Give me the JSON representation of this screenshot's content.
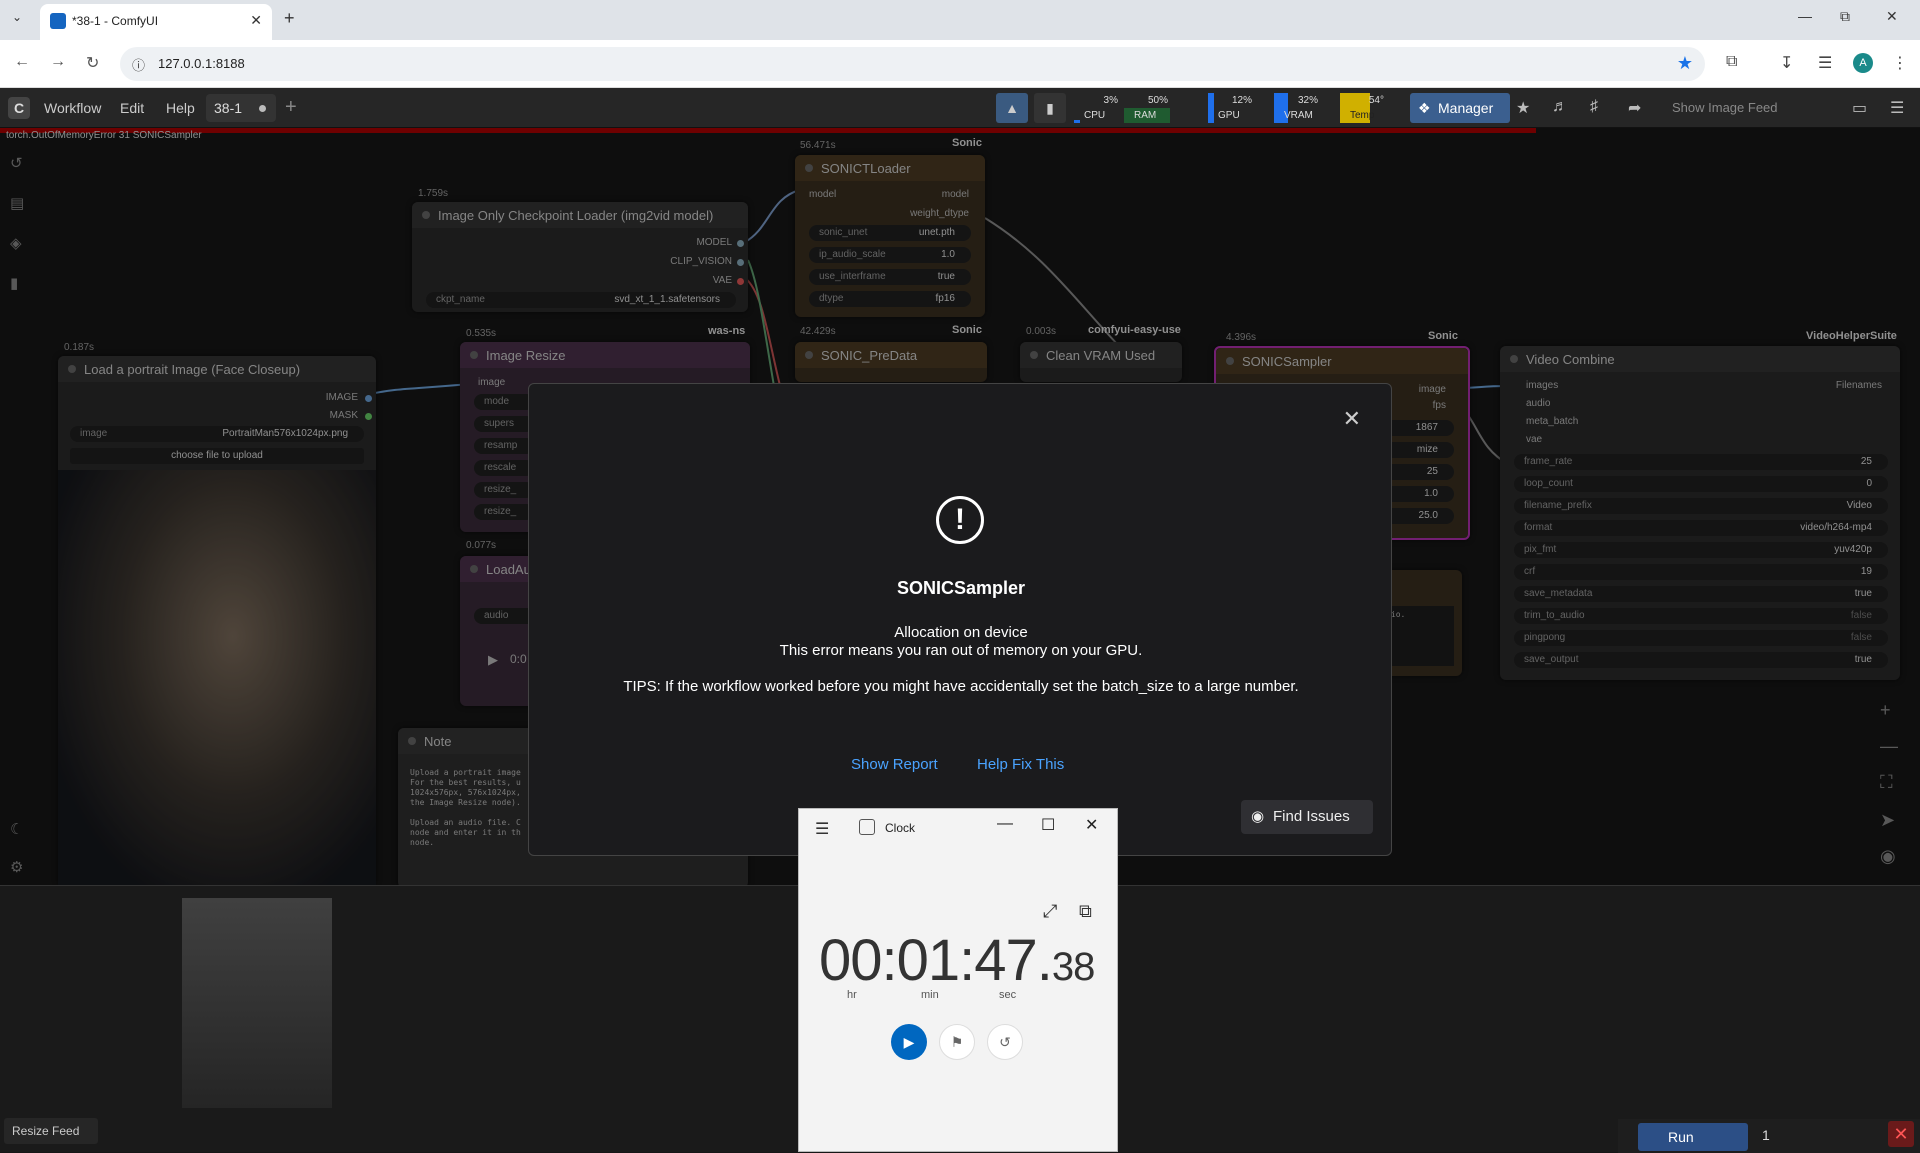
{
  "browser": {
    "tab_title": "*38-1 - ComfyUI",
    "url": "127.0.0.1:8188",
    "avatar_letter": "A"
  },
  "comfy": {
    "menu": [
      "Workflow",
      "Edit",
      "Help"
    ],
    "workflow_tab": "38-1",
    "monitors": [
      {
        "label": "CPU",
        "pct": "3%",
        "color": "#1f6feb"
      },
      {
        "label": "RAM",
        "pct": "50%",
        "color": "#1a7f37"
      },
      {
        "label": "GPU",
        "pct": "12%",
        "color": "#1f6feb"
      },
      {
        "label": "VRAM",
        "pct": "32%",
        "color": "#1f6feb"
      },
      {
        "label": "Temp",
        "pct": "54°",
        "color": "#d0b000"
      }
    ],
    "manager_label": "Manager",
    "show_feed_label": "Show Image Feed",
    "error_strip": "torch.OutOfMemoryError 31 SONICSampler"
  },
  "nodes": {
    "checkpoint": {
      "time": "1.759s",
      "title": "Image Only Checkpoint Loader (img2vid model)",
      "outputs": [
        "MODEL",
        "CLIP_VISION",
        "VAE"
      ],
      "ckpt_label": "ckpt_name",
      "ckpt_value": "svd_xt_1_1.safetensors"
    },
    "loader": {
      "time": "56.471s",
      "group": "Sonic",
      "title": "SONICTLoader",
      "in_model": "model",
      "out_model": "model",
      "out_dtype": "weight_dtype",
      "widgets": [
        {
          "l": "sonic_unet",
          "v": "unet.pth"
        },
        {
          "l": "ip_audio_scale",
          "v": "1.0"
        },
        {
          "l": "use_interframe",
          "v": "true"
        },
        {
          "l": "dtype",
          "v": "fp16"
        }
      ]
    },
    "portrait": {
      "time": "0.187s",
      "title": "Load a portrait Image (Face Closeup)",
      "outputs": [
        "IMAGE",
        "MASK"
      ],
      "image_label": "image",
      "image_value": "PortraitMan576x1024px.png",
      "upload_label": "choose file to upload"
    },
    "resize": {
      "time": "0.535s",
      "group": "was-ns",
      "title": "Image Resize",
      "input": "image",
      "widgets": [
        "mode",
        "supers",
        "resamp",
        "rescale",
        "resize_",
        "resize_"
      ]
    },
    "predata": {
      "time": "42.429s",
      "group": "Sonic",
      "title": "SONIC_PreData"
    },
    "cleanvram": {
      "time": "0.003s",
      "group": "comfyui-easy-use",
      "title": "Clean VRAM Used"
    },
    "sampler": {
      "time": "4.396s",
      "group": "Sonic",
      "title": "SONICSampler",
      "out_image": "image",
      "out_fps": "fps",
      "values": [
        "1867",
        "mize",
        "25",
        "1.0",
        "25.0"
      ]
    },
    "loadaudio": {
      "time": "0.077s",
      "title": "LoadAu",
      "widget": "audio",
      "play_time": "0:0"
    },
    "note": {
      "title": "Note",
      "text": "Upload a portrait image\nFor the best results, u\n1024x576px, 576x1024px,\nthe Image Resize node).\n\nUpload an audio file. C\nnode and enter it in th\nnode."
    },
    "previewtext": "he audio.",
    "videocombine": {
      "group": "VideoHelperSuite",
      "title": "Video Combine",
      "inputs": [
        "images",
        "audio",
        "meta_batch",
        "vae"
      ],
      "output": "Filenames",
      "widgets": [
        {
          "l": "frame_rate",
          "v": "25"
        },
        {
          "l": "loop_count",
          "v": "0"
        },
        {
          "l": "filename_prefix",
          "v": "Video"
        },
        {
          "l": "format",
          "v": "video/h264-mp4"
        },
        {
          "l": "pix_fmt",
          "v": "yuv420p"
        },
        {
          "l": "crf",
          "v": "19"
        },
        {
          "l": "save_metadata",
          "v": "true"
        },
        {
          "l": "trim_to_audio",
          "v": "false"
        },
        {
          "l": "pingpong",
          "v": "false"
        },
        {
          "l": "save_output",
          "v": "true"
        }
      ]
    }
  },
  "dialog": {
    "title": "SONICSampler",
    "line1": "Allocation on device",
    "line2": "This error means you ran out of memory on your GPU.",
    "tips": "TIPS: If the workflow worked before you might have accidentally set the batch_size to a large number.",
    "show_report": "Show Report",
    "help_fix": "Help Fix This",
    "find_issues": "Find Issues"
  },
  "feed": {
    "resize_label": "Resize Feed",
    "run_label": "Run",
    "queue_count": "1"
  },
  "clock": {
    "title": "Clock",
    "hours": "00",
    "minutes": "01",
    "seconds": "47",
    "centis": "38",
    "unit_hr": "hr",
    "unit_min": "min",
    "unit_sec": "sec"
  }
}
